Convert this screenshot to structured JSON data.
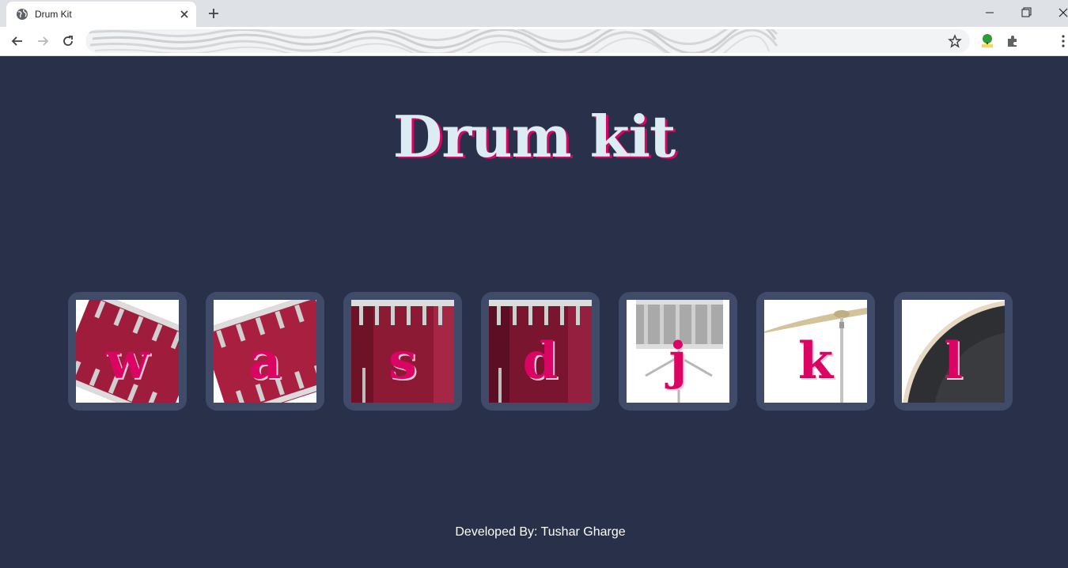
{
  "browser": {
    "tab_title": "Drum Kit",
    "url": ""
  },
  "page": {
    "heading": "Drum kit",
    "footer": "Developed By: Tushar Gharge"
  },
  "drums": [
    {
      "key": "w",
      "icon": "tom-drum-tilted-icon"
    },
    {
      "key": "a",
      "icon": "tom-drum-tilted-icon"
    },
    {
      "key": "s",
      "icon": "tom-drum-icon"
    },
    {
      "key": "d",
      "icon": "tom-drum-icon"
    },
    {
      "key": "j",
      "icon": "snare-drum-icon"
    },
    {
      "key": "k",
      "icon": "cymbal-icon"
    },
    {
      "key": "l",
      "icon": "bass-drum-icon"
    }
  ],
  "colors": {
    "background": "#283149",
    "button": "#404b69",
    "accent": "#da0463",
    "heading": "#dbedf3"
  }
}
